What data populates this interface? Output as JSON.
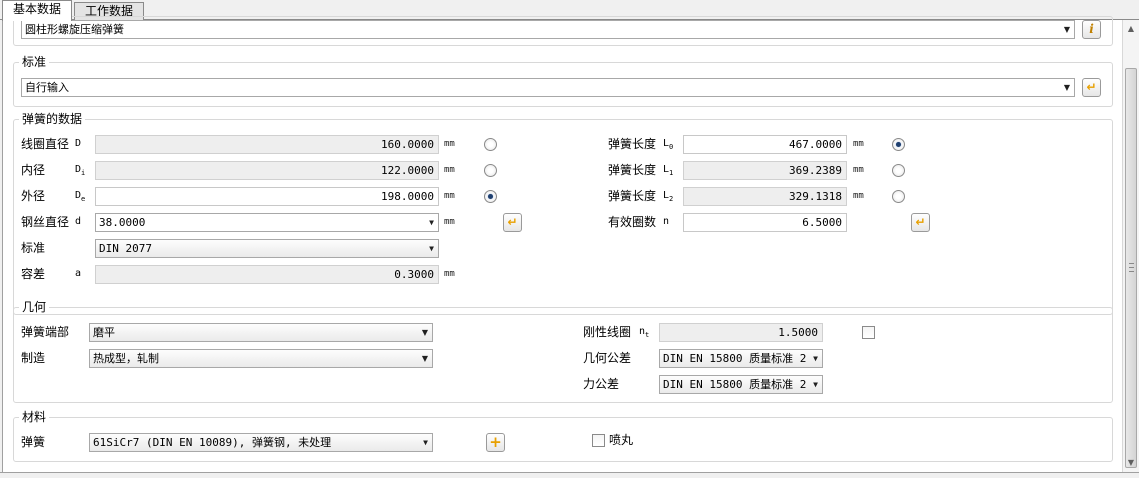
{
  "tabs": [
    {
      "label": "基本数据",
      "active": true
    },
    {
      "label": "工作数据",
      "active": false
    }
  ],
  "spring_type": {
    "value": "圆柱形螺旋压缩弹簧"
  },
  "standard_group": {
    "title": "标准",
    "value": "自行输入"
  },
  "spring_data": {
    "title": "弹簧的数据",
    "coil_diameter": {
      "label": "线圈直径",
      "symbol": "D",
      "value": "160.0000",
      "unit": "mm",
      "selected": false
    },
    "inner_diameter": {
      "label": "内径",
      "symbol": "D",
      "sub": "i",
      "value": "122.0000",
      "unit": "mm",
      "selected": false
    },
    "outer_diameter": {
      "label": "外径",
      "symbol": "D",
      "sub": "e",
      "value": "198.0000",
      "unit": "mm",
      "selected": true
    },
    "wire_diameter": {
      "label": "钢丝直径",
      "symbol": "d",
      "value": "38.0000",
      "unit": "mm"
    },
    "standard": {
      "label": "标准",
      "value": "DIN 2077"
    },
    "tolerance": {
      "label": "容差",
      "symbol": "a",
      "value": "0.3000",
      "unit": "mm"
    },
    "length_l0": {
      "label": "弹簧长度",
      "symbol": "L",
      "sub": "0",
      "value": "467.0000",
      "unit": "mm",
      "selected": true
    },
    "length_l1": {
      "label": "弹簧长度",
      "symbol": "L",
      "sub": "1",
      "value": "369.2389",
      "unit": "mm",
      "selected": false
    },
    "length_l2": {
      "label": "弹簧长度",
      "symbol": "L",
      "sub": "2",
      "value": "329.1318",
      "unit": "mm",
      "selected": false
    },
    "active_coils": {
      "label": "有效圈数",
      "symbol": "n",
      "value": "6.5000"
    }
  },
  "geometry": {
    "title": "几何",
    "spring_end": {
      "label": "弹簧端部",
      "value": "磨平"
    },
    "manufacturing": {
      "label": "制造",
      "value": "热成型，轧制"
    },
    "rigid_coils": {
      "label": "刚性线圈",
      "symbol": "n",
      "sub": "t",
      "value": "1.5000",
      "checked": false
    },
    "geometric_tolerance": {
      "label": "几何公差",
      "value": "DIN EN 15800 质量标准 2"
    },
    "force_tolerance": {
      "label": "力公差",
      "value": "DIN EN 15800 质量标准 2"
    }
  },
  "material": {
    "title": "材料",
    "spring": {
      "label": "弹簧",
      "value": "61SiCr7 (DIN EN 10089), 弹簧钢, 未处理"
    },
    "shot_peened": {
      "label": "喷丸",
      "checked": false
    }
  },
  "icons": {
    "dropdown": "chevron-down-icon",
    "enter": "enter-arrow-icon",
    "info": "info-icon",
    "add": "plus-icon",
    "accent": "#e8a000"
  }
}
